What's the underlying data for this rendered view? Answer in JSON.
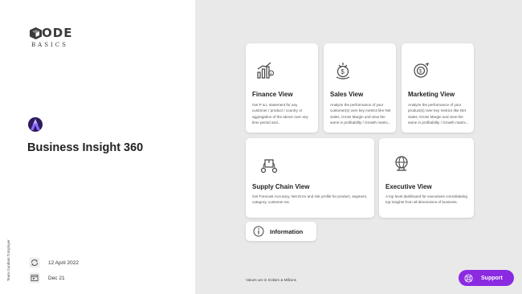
{
  "logo": {
    "text": "ODE",
    "subtext": "BASICS"
  },
  "app": {
    "title": "Business Insight 360"
  },
  "credit": "Team Gundam Tutoplayer",
  "meta": {
    "date": "12 April 2022",
    "period": "Dec 21"
  },
  "cards": [
    {
      "title": "Finance View",
      "desc": "Get P & L statement for any customer / product / country or aggregation of the above over any time period and...",
      "icon": "finance-chart-icon"
    },
    {
      "title": "Sales View",
      "desc": "Analyze the performance of your customer(s) over key metrics like Net Sales, Gross Margin and view the same in profitability / Growth matrix...",
      "icon": "sales-money-icon"
    },
    {
      "title": "Marketing View",
      "desc": "Analyze the performance of your product(s) over key metrics like Net Sales, Gross Margin and view the same in profitability / Growth matrix...",
      "icon": "marketing-target-icon"
    },
    {
      "title": "Supply Chain View",
      "desc": "Get Forecast Accuracy, Net Error and risk profile for product, segment, category, customer etc.",
      "icon": "supply-chain-icon"
    },
    {
      "title": "Executive View",
      "desc": "A top level dashboard for executives consolidating top insights from all dimensions of business.",
      "icon": "executive-globe-icon"
    }
  ],
  "info_button": {
    "label": "Information"
  },
  "footnote": "Values are in Dollars & Millions",
  "support_button": {
    "label": "Support"
  },
  "colors": {
    "accent": "#8a2be2",
    "background": "#e9e9ea",
    "panel": "#ffffff",
    "logo": "#3a3a3a"
  }
}
